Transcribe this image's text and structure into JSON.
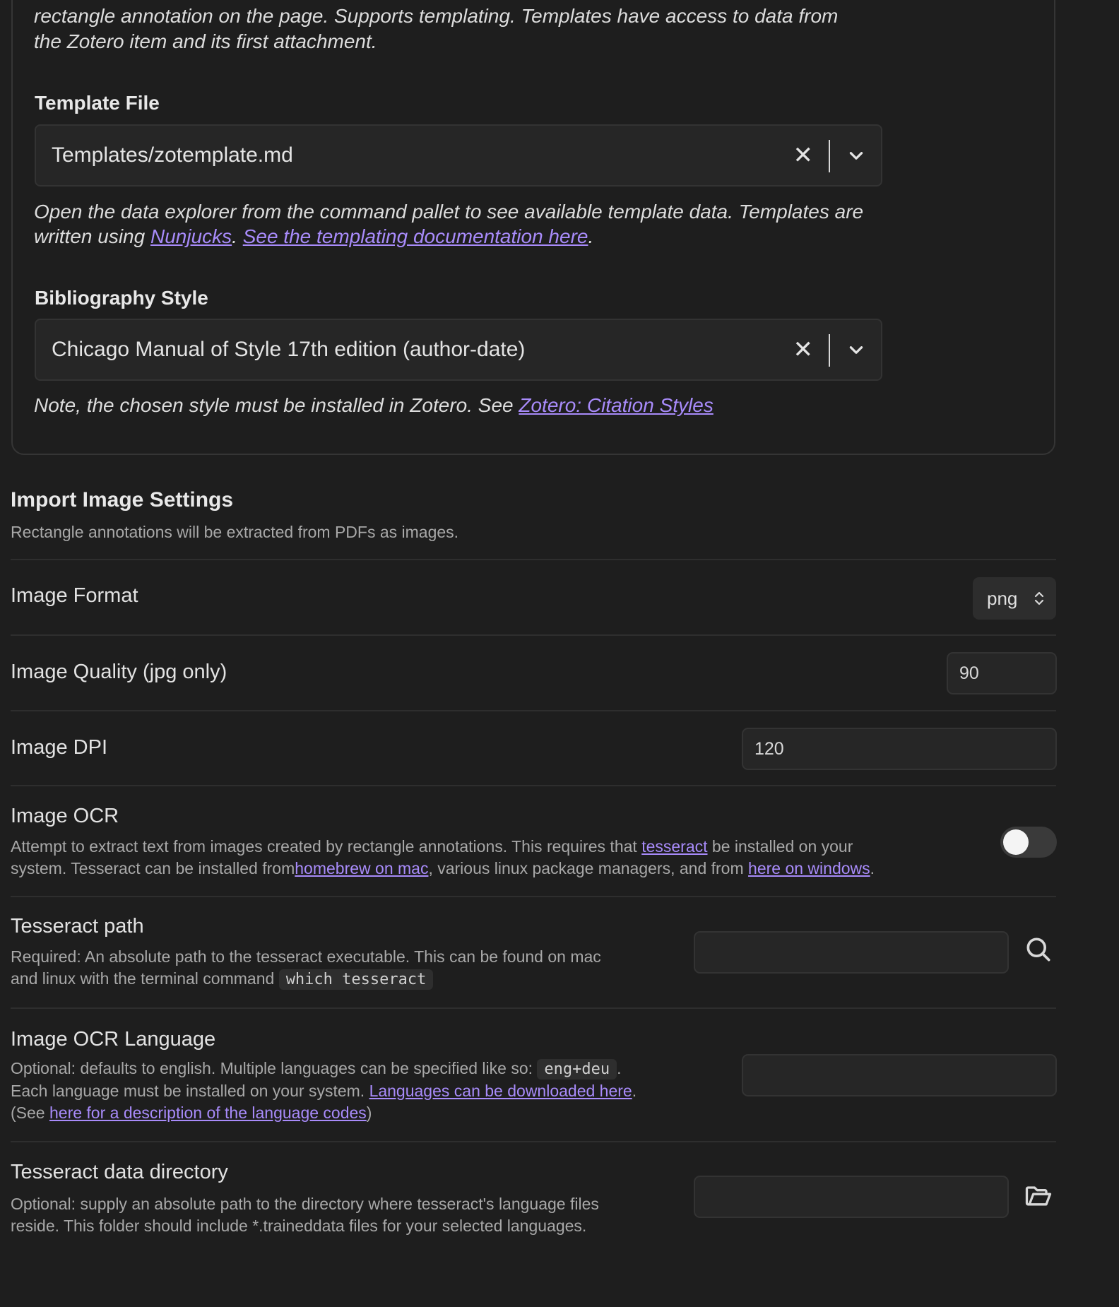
{
  "template_group": {
    "intro_line1": "rectangle annotation on the page. Supports templating. Templates have access to data from",
    "intro_line2": "the Zotero item and its first attachment.",
    "template_file": {
      "label": "Template File",
      "value": "Templates/zotemplate.md",
      "note_prefix": "Open the data explorer from the command pallet to see available template data. Templates are written using ",
      "link1": "Nunjucks",
      "mid": ". ",
      "link2": "See the templating documentation here",
      "suffix": "."
    },
    "bibliography_style": {
      "label": "Bibliography Style",
      "value": "Chicago Manual of Style 17th edition (author-date)",
      "note_prefix": "Note, the chosen style must be installed in Zotero. See ",
      "link": "Zotero: Citation Styles"
    }
  },
  "import_image": {
    "heading": "Import Image Settings",
    "description": "Rectangle annotations will be extracted from PDFs as images.",
    "image_format": {
      "name": "Image Format",
      "value": "png"
    },
    "image_quality": {
      "name": "Image Quality (jpg only)",
      "value": "90"
    },
    "image_dpi": {
      "name": "Image DPI",
      "value": "120"
    },
    "image_ocr": {
      "name": "Image OCR",
      "desc_1": "Attempt to extract text from images created by rectangle annotations. This requires that ",
      "link_tesseract": "tesseract",
      "desc_2": " be installed on your",
      "desc_3": "system. Tesseract can be installed from",
      "link_homebrew": "homebrew on mac",
      "desc_4": ", various linux package managers, and from ",
      "link_windows": "here on windows",
      "desc_5": ".",
      "enabled": false
    },
    "tesseract_path": {
      "name": "Tesseract path",
      "desc_1": "Required: An absolute path to the tesseract executable. This can be found on mac",
      "desc_2": "and linux with the terminal command ",
      "code": "which tesseract",
      "value": "",
      "icon": "search-icon"
    },
    "ocr_language": {
      "name": "Image OCR Language",
      "desc_1": "Optional: defaults to english. Multiple languages can be specified like so: ",
      "code": "eng+deu",
      "desc_1b": ".",
      "desc_2": "Each language must be installed on your system. ",
      "link_download": "Languages can be downloaded here",
      "desc_2b": ".",
      "desc_3a": "(See ",
      "link_codes": "here for a description of the language codes",
      "desc_3b": ")",
      "value": ""
    },
    "tesseract_data_dir": {
      "name": "Tesseract data directory",
      "desc_1": "Optional: supply an absolute path to the directory where tesseract's language files",
      "desc_2": "reside. This folder should include *.traineddata files for your selected languages.",
      "value": "",
      "icon": "folder-open-icon"
    }
  },
  "colors": {
    "background": "#1e1e1e",
    "link": "#a88bfa"
  }
}
